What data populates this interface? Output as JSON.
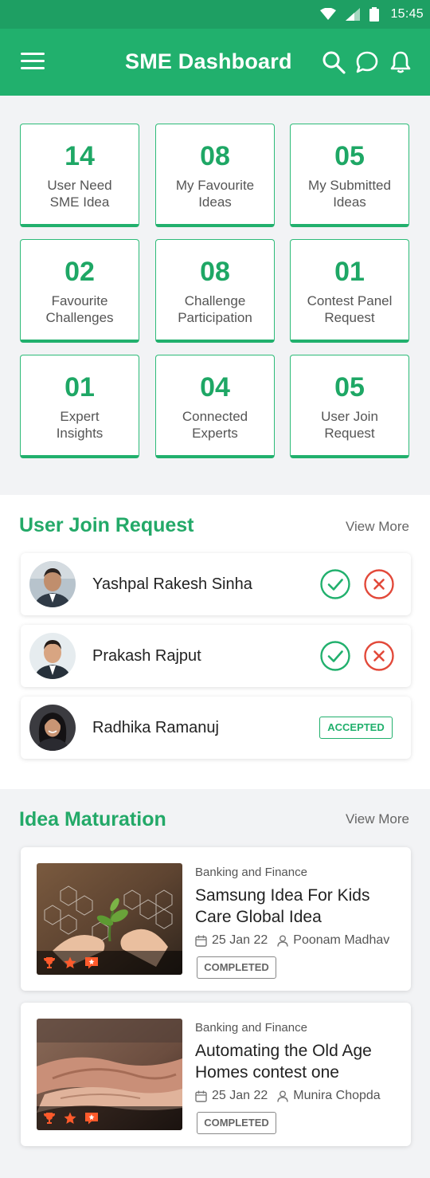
{
  "status_bar": {
    "time": "15:45"
  },
  "header": {
    "title": "SME Dashboard",
    "icons": [
      "menu-icon",
      "search-icon",
      "chat-icon",
      "bell-icon"
    ]
  },
  "stats": [
    {
      "value": "14",
      "label": "User Need\nSME Idea"
    },
    {
      "value": "08",
      "label": "My Favourite\nIdeas"
    },
    {
      "value": "05",
      "label": "My Submitted\nIdeas"
    },
    {
      "value": "02",
      "label": "Favourite\nChallenges"
    },
    {
      "value": "08",
      "label": "Challenge\nParticipation"
    },
    {
      "value": "01",
      "label": "Contest Panel\nRequest"
    },
    {
      "value": "01",
      "label": "Expert\nInsights"
    },
    {
      "value": "04",
      "label": "Connected\nExperts"
    },
    {
      "value": "05",
      "label": "User Join\nRequest"
    }
  ],
  "join_requests": {
    "title": "User Join Request",
    "view_more": "View More",
    "items": [
      {
        "name": "Yashpal Rakesh Sinha",
        "status": "pending"
      },
      {
        "name": "Prakash Rajput",
        "status": "pending"
      },
      {
        "name": "Radhika Ramanuj",
        "status": "accepted",
        "badge": "ACCEPTED"
      }
    ]
  },
  "ideas": {
    "title": "Idea Maturation",
    "view_more": "View More",
    "items": [
      {
        "category": "Banking and Finance",
        "title": "Samsung Idea For Kids Care Global Idea",
        "date": "25 Jan 22",
        "author": "Poonam Madhav",
        "status": "COMPLETED"
      },
      {
        "category": "Banking and Finance",
        "title": "Automating the Old Age Homes contest one",
        "date": "25 Jan 22",
        "author": "Munira Chopda",
        "status": "COMPLETED"
      }
    ]
  },
  "colors": {
    "primary": "#21b06d",
    "status_bar": "#1e9f63",
    "accept": "#21b06d",
    "reject": "#e2493a"
  }
}
